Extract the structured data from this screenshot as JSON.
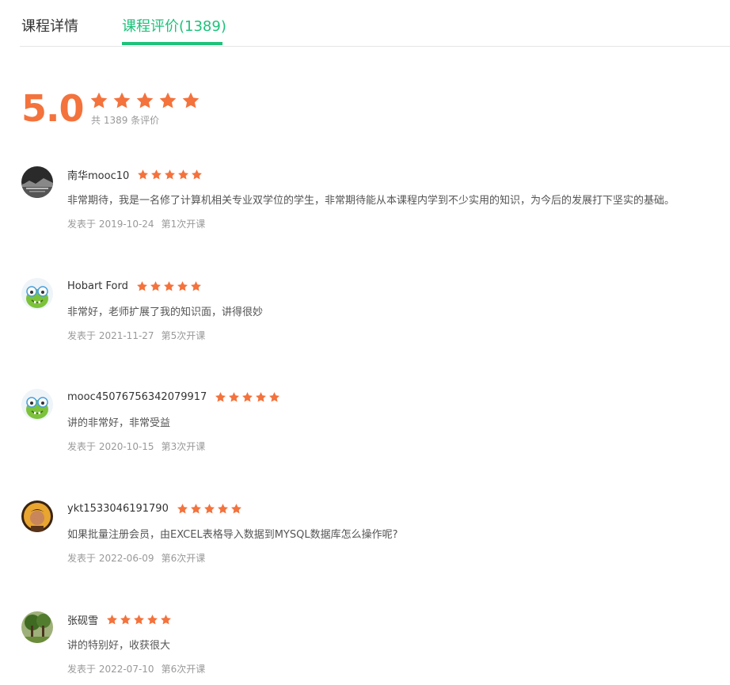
{
  "tabs": [
    {
      "label": "课程详情",
      "active": false
    },
    {
      "label": "课程评价(1389)",
      "active": true
    }
  ],
  "summary": {
    "score": "5.0",
    "stars": 5,
    "count_text": "共 1389 条评价"
  },
  "colors": {
    "accent": "#1ec27b",
    "star": "#f4723c"
  },
  "reviews": [
    {
      "username": "南华mooc10",
      "rating": 5,
      "content": "非常期待，我是一名修了计算机相关专业双学位的学生，非常期待能从本课程内学到不少实用的知识，为今后的发展打下坚实的基础。",
      "date": "发表于 2019-10-24",
      "session": "第1次开课",
      "avatar": "dark-landscape-avatar"
    },
    {
      "username": "Hobart Ford",
      "rating": 5,
      "content": "非常好，老师扩展了我的知识面，讲得很妙",
      "date": "发表于 2021-11-27",
      "session": "第5次开课",
      "avatar": "green-monster-avatar"
    },
    {
      "username": "mooc45076756342079917",
      "rating": 5,
      "content": "讲的非常好，非常受益",
      "date": "发表于 2020-10-15",
      "session": "第3次开课",
      "avatar": "green-monster-avatar"
    },
    {
      "username": "ykt1533046191790",
      "rating": 5,
      "content": "如果批量注册会员，由EXCEL表格导入数据到MYSQL数据库怎么操作呢?",
      "date": "发表于 2022-06-09",
      "session": "第6次开课",
      "avatar": "person-photo-avatar"
    },
    {
      "username": "张砚雪",
      "rating": 5,
      "content": "讲的特别好，收获很大",
      "date": "发表于 2022-07-10",
      "session": "第6次开课",
      "avatar": "tree-photo-avatar"
    }
  ]
}
